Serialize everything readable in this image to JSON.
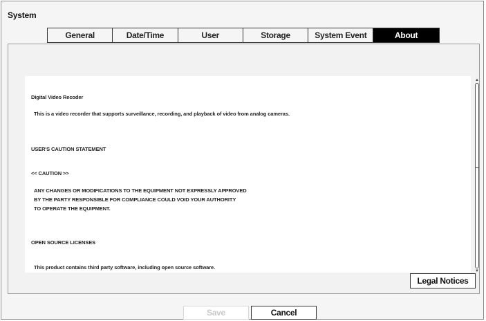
{
  "window": {
    "title": "System"
  },
  "tabs": [
    {
      "label": "General"
    },
    {
      "label": "Date/Time"
    },
    {
      "label": "User"
    },
    {
      "label": "Storage"
    },
    {
      "label": "System Event"
    },
    {
      "label": "About",
      "active": true
    }
  ],
  "about": {
    "lines": [
      "Digital Video Recoder",
      "This is a video recorder that supports surveillance, recording, and playback of video from analog cameras.",
      "USER'S CAUTION STATEMENT",
      "<< CAUTION >>",
      "ANY CHANGES OR MODIFICATIONS TO THE EQUIPMENT NOT EXPRESSLY APPROVED",
      "BY THE PARTY RESPONSIBLE FOR COMPLIANCE COULD VOID YOUR AUTHORITY",
      "TO OPERATE THE EQUIPMENT.",
      "OPEN SOURCE LICENSES",
      "This product contains third party software, including open source software."
    ],
    "legal_button": "Legal Notices"
  },
  "footer": {
    "save_label": "Save",
    "save_enabled": false,
    "cancel_label": "Cancel"
  },
  "scrollbar": {
    "up_icon": "up-arrow-icon",
    "down_icon": "down-arrow-icon"
  }
}
